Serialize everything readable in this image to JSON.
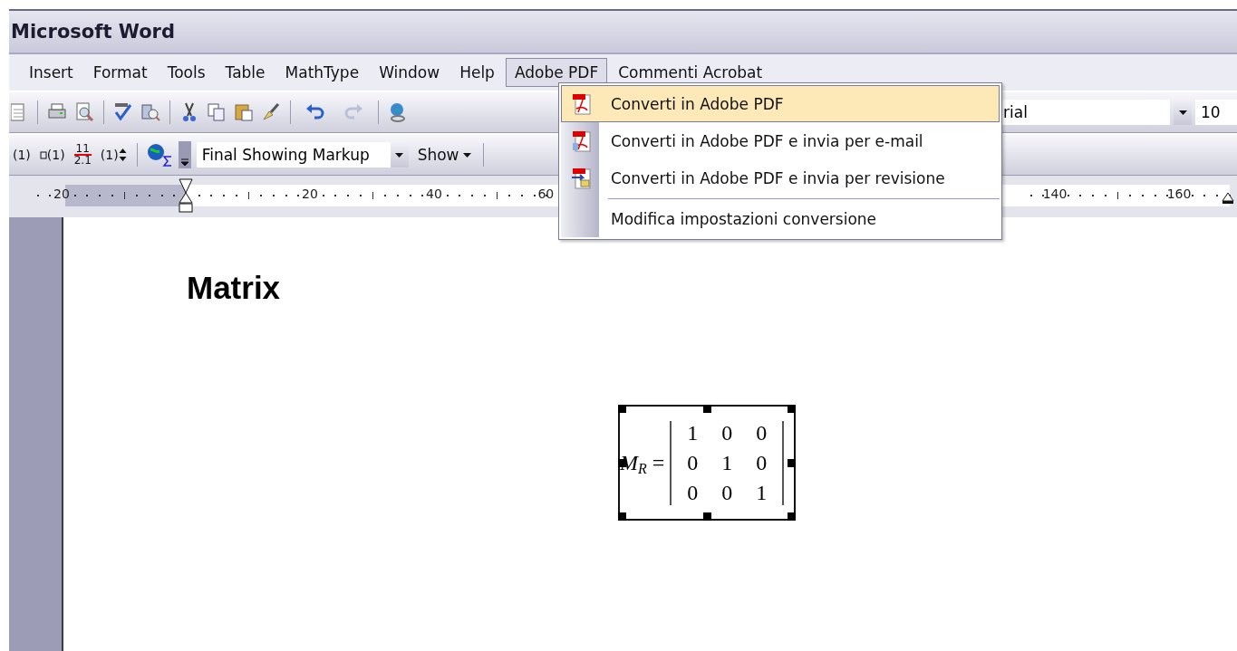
{
  "window": {
    "title": "Microsoft Word"
  },
  "menu_bar": [
    {
      "label": "Insert",
      "selected": false
    },
    {
      "label": "Format",
      "selected": false
    },
    {
      "label": "Tools",
      "selected": false
    },
    {
      "label": "Table",
      "selected": false
    },
    {
      "label": "MathType",
      "selected": false
    },
    {
      "label": "Window",
      "selected": false
    },
    {
      "label": "Help",
      "selected": false
    },
    {
      "label": "Adobe PDF",
      "selected": true
    },
    {
      "label": "Commenti Acrobat",
      "selected": false
    }
  ],
  "dropdown_menu": [
    {
      "kind": "pdf",
      "label": "Converti in Adobe PDF",
      "selected": true,
      "separator_before": false
    },
    {
      "kind": "pdf-mail",
      "label": "Converti in Adobe PDF e invia per e-mail",
      "selected": false,
      "separator_before": false
    },
    {
      "kind": "pdf-review",
      "label": "Converti in Adobe PDF e invia per revisione",
      "selected": false,
      "separator_before": false
    },
    {
      "kind": "plain",
      "label": "Modifica impostazioni conversione",
      "selected": false,
      "separator_before": true
    }
  ],
  "formatting": {
    "font_name": "rial",
    "font_size": "10"
  },
  "equation_buttons": [
    {
      "kind": "plain",
      "label": "(1)"
    },
    {
      "kind": "insert",
      "label": "(1)"
    },
    {
      "kind": "fraction",
      "label": "11",
      "sub": "2.1"
    },
    {
      "kind": "update",
      "label": "(1)"
    }
  ],
  "reviewing": {
    "display": "Final Showing Markup",
    "show": "Show"
  },
  "ruler": {
    "labels": [
      "20",
      "20",
      "40",
      "60",
      "140",
      "160"
    ]
  },
  "document": {
    "heading": "Matrix",
    "equation": {
      "symbol": "M",
      "subscript": "R",
      "operator": "=",
      "rows": [
        [
          "1",
          "0",
          "0"
        ],
        [
          "0",
          "1",
          "0"
        ],
        [
          "0",
          "0",
          "1"
        ]
      ]
    }
  }
}
